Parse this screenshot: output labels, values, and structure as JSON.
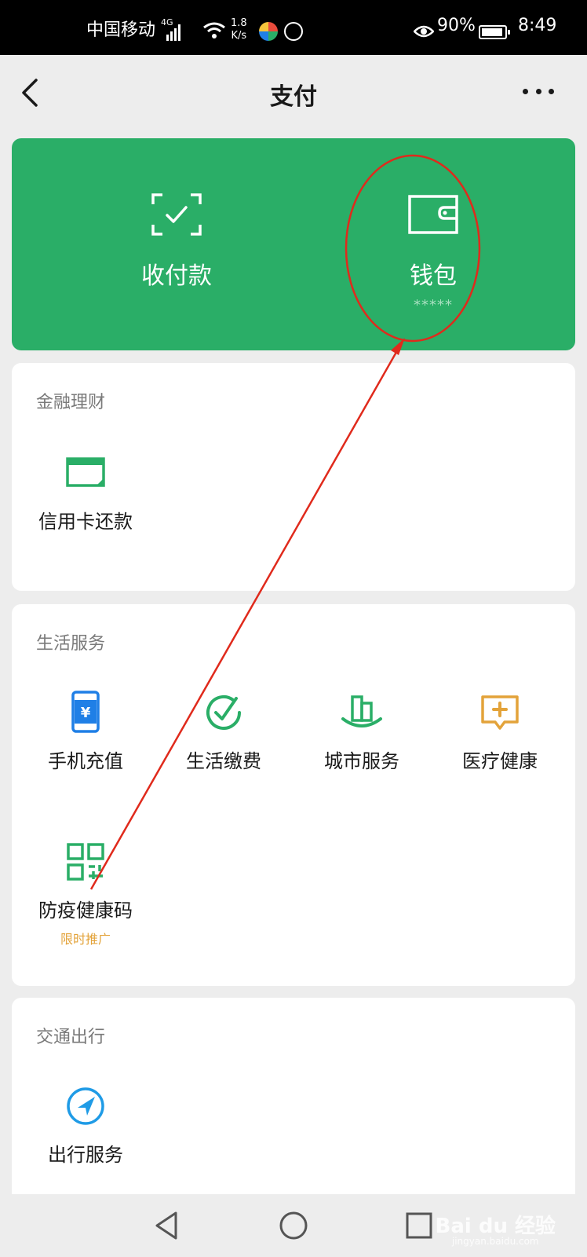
{
  "status_bar": {
    "carrier": "中国移动",
    "network": "4G",
    "speed_value": "1.8",
    "speed_unit": "K/s",
    "battery_percent": "90%",
    "time": "8:49"
  },
  "header": {
    "title": "支付"
  },
  "hero": {
    "pay_label": "收付款",
    "wallet_label": "钱包",
    "wallet_balance": "*****",
    "color": "#2aae67"
  },
  "sections": {
    "finance": {
      "title": "金融理财",
      "items": [
        {
          "label": "信用卡还款",
          "icon": "credit-card-icon",
          "color": "#2aae67"
        }
      ]
    },
    "life": {
      "title": "生活服务",
      "items": [
        {
          "label": "手机充值",
          "icon": "phone-recharge-icon",
          "color": "#1f7fe6"
        },
        {
          "label": "生活缴费",
          "icon": "bill-check-icon",
          "color": "#2aae67"
        },
        {
          "label": "城市服务",
          "icon": "city-building-icon",
          "color": "#2aae67"
        },
        {
          "label": "医疗健康",
          "icon": "medical-icon",
          "color": "#e3a33a"
        },
        {
          "label": "防疫健康码",
          "icon": "qr-code-icon",
          "color": "#2aae67",
          "promo": "限时推广"
        }
      ]
    },
    "traffic": {
      "title": "交通出行",
      "items": [
        {
          "label": "出行服务",
          "icon": "navigation-icon",
          "color": "#1f9be6"
        }
      ]
    }
  },
  "watermark": {
    "brand": "Bai du 经验",
    "url": "jingyan.baidu.com"
  }
}
